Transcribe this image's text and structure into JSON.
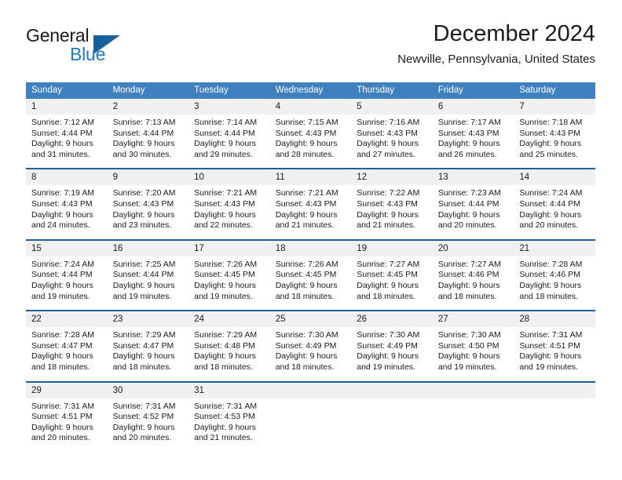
{
  "brand": {
    "name_part1": "General",
    "name_part2": "Blue",
    "logo_icon": "triangle-logo-icon"
  },
  "header": {
    "title": "December 2024",
    "subtitle": "Newville, Pennsylvania, United States"
  },
  "colors": {
    "header_blue": "#3f81c0",
    "separator_blue": "#1f5fa0",
    "daynum_band": "#f0f0f0",
    "brand_blue": "#1f7bc1",
    "text": "#1b1b1b"
  },
  "calendar": {
    "day_headers": [
      "Sunday",
      "Monday",
      "Tuesday",
      "Wednesday",
      "Thursday",
      "Friday",
      "Saturday"
    ],
    "weeks": [
      [
        {
          "day": "1",
          "lines": [
            "Sunrise: 7:12 AM",
            "Sunset: 4:44 PM",
            "Daylight: 9 hours",
            "and 31 minutes."
          ]
        },
        {
          "day": "2",
          "lines": [
            "Sunrise: 7:13 AM",
            "Sunset: 4:44 PM",
            "Daylight: 9 hours",
            "and 30 minutes."
          ]
        },
        {
          "day": "3",
          "lines": [
            "Sunrise: 7:14 AM",
            "Sunset: 4:44 PM",
            "Daylight: 9 hours",
            "and 29 minutes."
          ]
        },
        {
          "day": "4",
          "lines": [
            "Sunrise: 7:15 AM",
            "Sunset: 4:43 PM",
            "Daylight: 9 hours",
            "and 28 minutes."
          ]
        },
        {
          "day": "5",
          "lines": [
            "Sunrise: 7:16 AM",
            "Sunset: 4:43 PM",
            "Daylight: 9 hours",
            "and 27 minutes."
          ]
        },
        {
          "day": "6",
          "lines": [
            "Sunrise: 7:17 AM",
            "Sunset: 4:43 PM",
            "Daylight: 9 hours",
            "and 26 minutes."
          ]
        },
        {
          "day": "7",
          "lines": [
            "Sunrise: 7:18 AM",
            "Sunset: 4:43 PM",
            "Daylight: 9 hours",
            "and 25 minutes."
          ]
        }
      ],
      [
        {
          "day": "8",
          "lines": [
            "Sunrise: 7:19 AM",
            "Sunset: 4:43 PM",
            "Daylight: 9 hours",
            "and 24 minutes."
          ]
        },
        {
          "day": "9",
          "lines": [
            "Sunrise: 7:20 AM",
            "Sunset: 4:43 PM",
            "Daylight: 9 hours",
            "and 23 minutes."
          ]
        },
        {
          "day": "10",
          "lines": [
            "Sunrise: 7:21 AM",
            "Sunset: 4:43 PM",
            "Daylight: 9 hours",
            "and 22 minutes."
          ]
        },
        {
          "day": "11",
          "lines": [
            "Sunrise: 7:21 AM",
            "Sunset: 4:43 PM",
            "Daylight: 9 hours",
            "and 21 minutes."
          ]
        },
        {
          "day": "12",
          "lines": [
            "Sunrise: 7:22 AM",
            "Sunset: 4:43 PM",
            "Daylight: 9 hours",
            "and 21 minutes."
          ]
        },
        {
          "day": "13",
          "lines": [
            "Sunrise: 7:23 AM",
            "Sunset: 4:44 PM",
            "Daylight: 9 hours",
            "and 20 minutes."
          ]
        },
        {
          "day": "14",
          "lines": [
            "Sunrise: 7:24 AM",
            "Sunset: 4:44 PM",
            "Daylight: 9 hours",
            "and 20 minutes."
          ]
        }
      ],
      [
        {
          "day": "15",
          "lines": [
            "Sunrise: 7:24 AM",
            "Sunset: 4:44 PM",
            "Daylight: 9 hours",
            "and 19 minutes."
          ]
        },
        {
          "day": "16",
          "lines": [
            "Sunrise: 7:25 AM",
            "Sunset: 4:44 PM",
            "Daylight: 9 hours",
            "and 19 minutes."
          ]
        },
        {
          "day": "17",
          "lines": [
            "Sunrise: 7:26 AM",
            "Sunset: 4:45 PM",
            "Daylight: 9 hours",
            "and 19 minutes."
          ]
        },
        {
          "day": "18",
          "lines": [
            "Sunrise: 7:26 AM",
            "Sunset: 4:45 PM",
            "Daylight: 9 hours",
            "and 18 minutes."
          ]
        },
        {
          "day": "19",
          "lines": [
            "Sunrise: 7:27 AM",
            "Sunset: 4:45 PM",
            "Daylight: 9 hours",
            "and 18 minutes."
          ]
        },
        {
          "day": "20",
          "lines": [
            "Sunrise: 7:27 AM",
            "Sunset: 4:46 PM",
            "Daylight: 9 hours",
            "and 18 minutes."
          ]
        },
        {
          "day": "21",
          "lines": [
            "Sunrise: 7:28 AM",
            "Sunset: 4:46 PM",
            "Daylight: 9 hours",
            "and 18 minutes."
          ]
        }
      ],
      [
        {
          "day": "22",
          "lines": [
            "Sunrise: 7:28 AM",
            "Sunset: 4:47 PM",
            "Daylight: 9 hours",
            "and 18 minutes."
          ]
        },
        {
          "day": "23",
          "lines": [
            "Sunrise: 7:29 AM",
            "Sunset: 4:47 PM",
            "Daylight: 9 hours",
            "and 18 minutes."
          ]
        },
        {
          "day": "24",
          "lines": [
            "Sunrise: 7:29 AM",
            "Sunset: 4:48 PM",
            "Daylight: 9 hours",
            "and 18 minutes."
          ]
        },
        {
          "day": "25",
          "lines": [
            "Sunrise: 7:30 AM",
            "Sunset: 4:49 PM",
            "Daylight: 9 hours",
            "and 18 minutes."
          ]
        },
        {
          "day": "26",
          "lines": [
            "Sunrise: 7:30 AM",
            "Sunset: 4:49 PM",
            "Daylight: 9 hours",
            "and 19 minutes."
          ]
        },
        {
          "day": "27",
          "lines": [
            "Sunrise: 7:30 AM",
            "Sunset: 4:50 PM",
            "Daylight: 9 hours",
            "and 19 minutes."
          ]
        },
        {
          "day": "28",
          "lines": [
            "Sunrise: 7:31 AM",
            "Sunset: 4:51 PM",
            "Daylight: 9 hours",
            "and 19 minutes."
          ]
        }
      ],
      [
        {
          "day": "29",
          "lines": [
            "Sunrise: 7:31 AM",
            "Sunset: 4:51 PM",
            "Daylight: 9 hours",
            "and 20 minutes."
          ]
        },
        {
          "day": "30",
          "lines": [
            "Sunrise: 7:31 AM",
            "Sunset: 4:52 PM",
            "Daylight: 9 hours",
            "and 20 minutes."
          ]
        },
        {
          "day": "31",
          "lines": [
            "Sunrise: 7:31 AM",
            "Sunset: 4:53 PM",
            "Daylight: 9 hours",
            "and 21 minutes."
          ]
        },
        {
          "day": "",
          "lines": []
        },
        {
          "day": "",
          "lines": []
        },
        {
          "day": "",
          "lines": []
        },
        {
          "day": "",
          "lines": []
        }
      ]
    ]
  }
}
